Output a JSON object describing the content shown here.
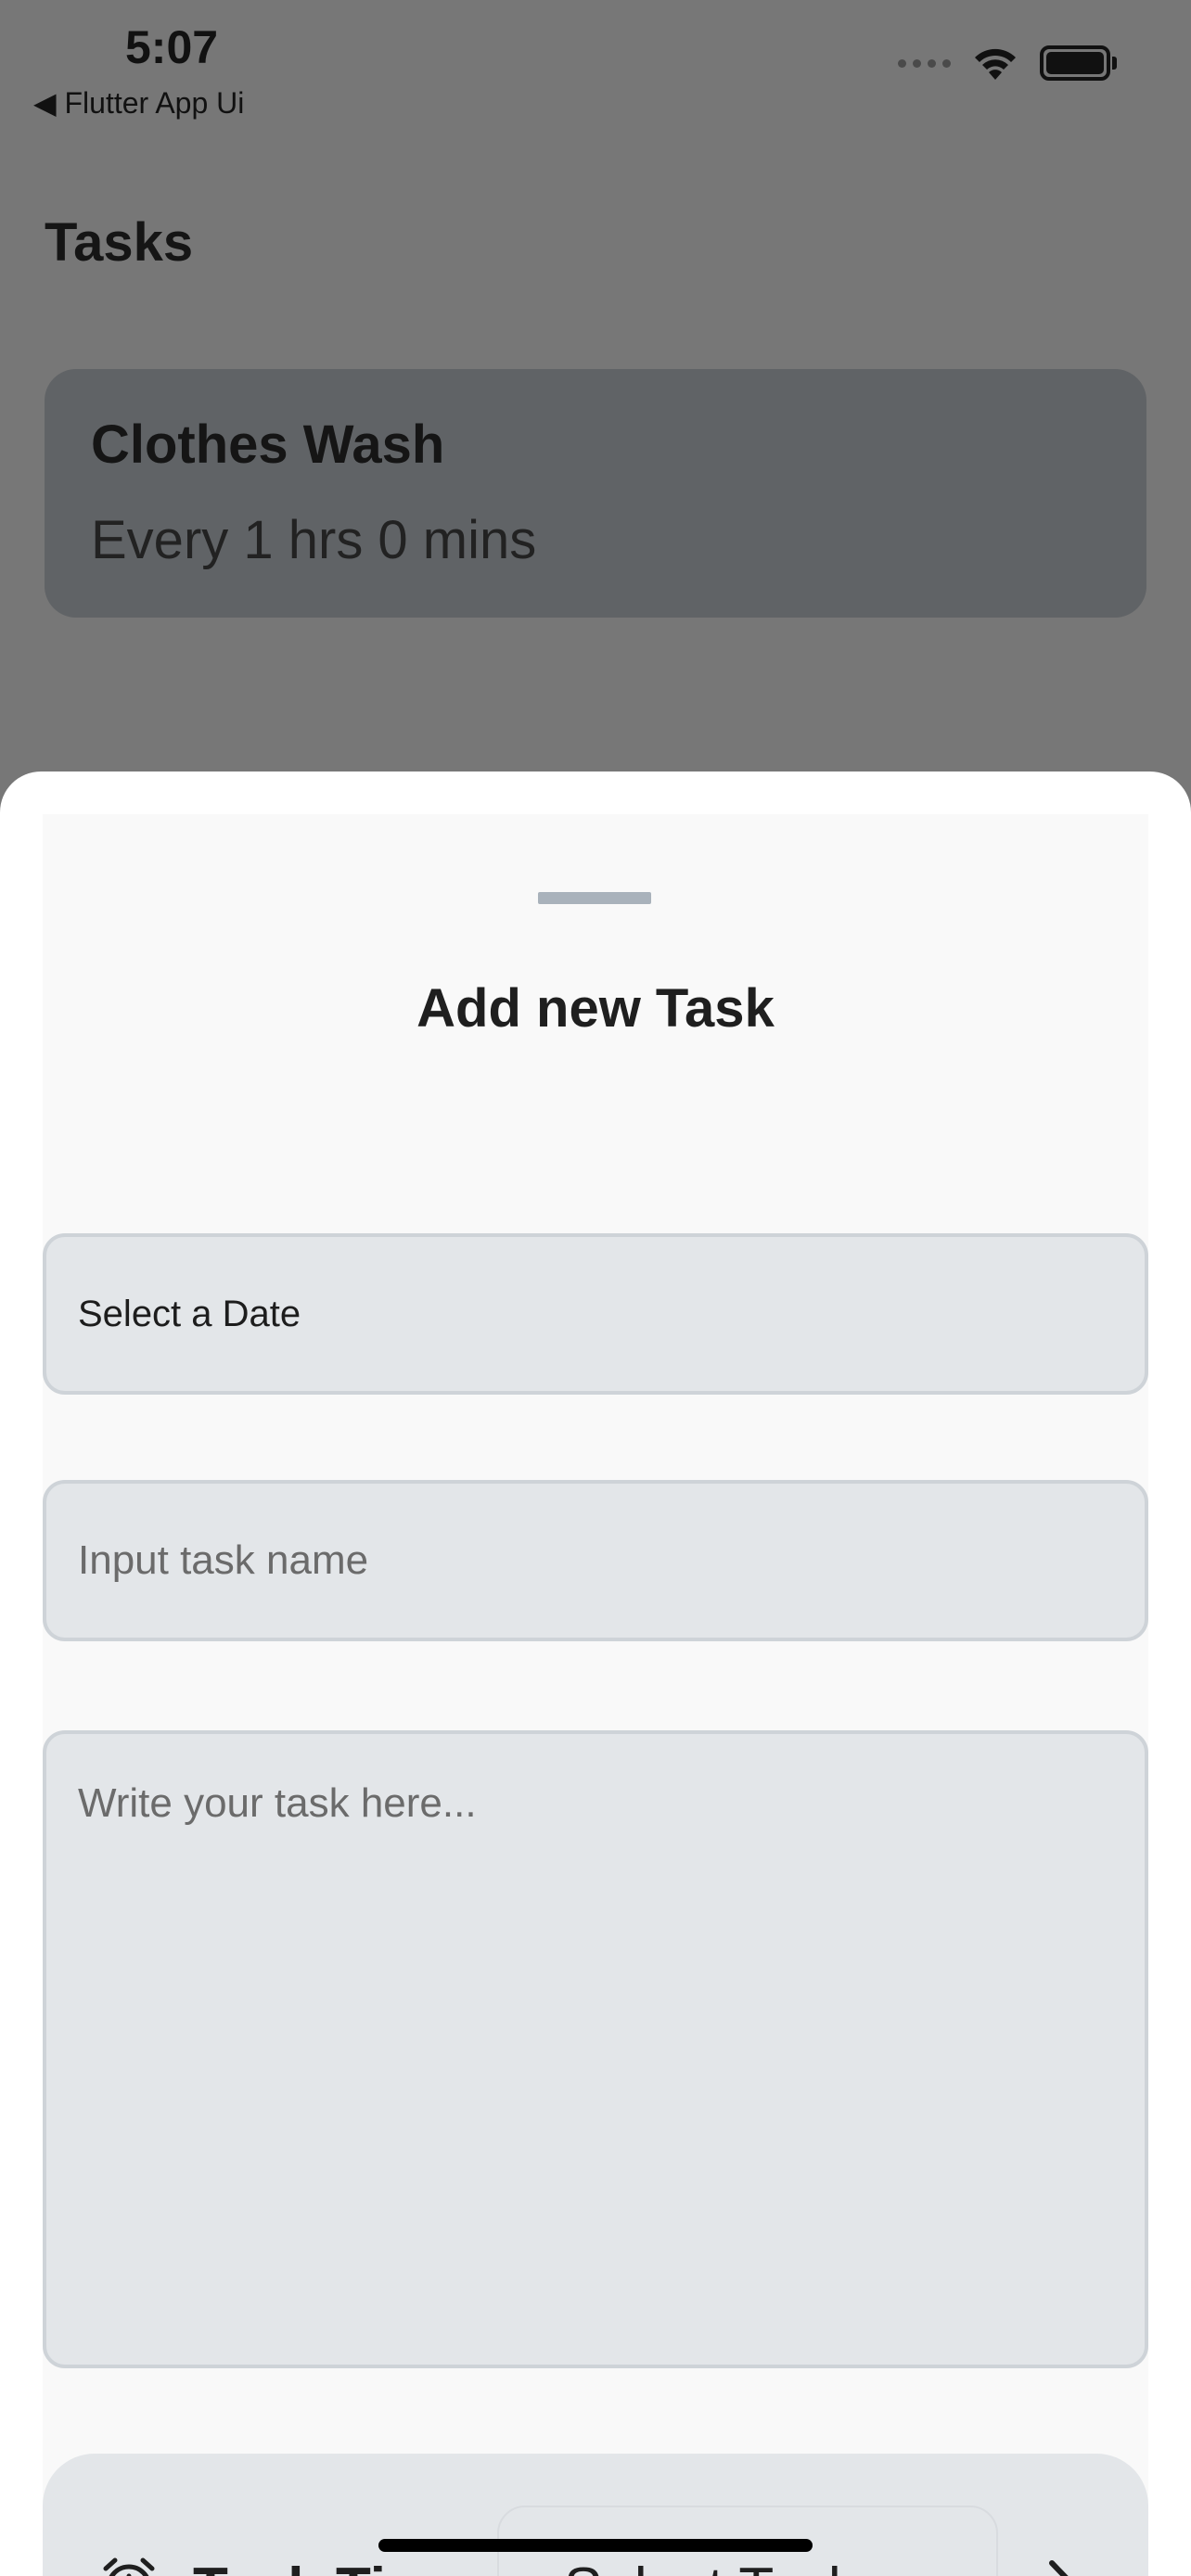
{
  "status_bar": {
    "time": "5:07",
    "back_label": "◀ Flutter App Ui",
    "icons": [
      "signal-dots-icon",
      "wifi-icon",
      "battery-icon"
    ]
  },
  "page": {
    "title": "Tasks"
  },
  "tasks": [
    {
      "name": "Clothes Wash",
      "interval": "Every 1 hrs 0 mins"
    }
  ],
  "sheet": {
    "title": "Add new Task",
    "date_field": "Select a Date",
    "name_field": {
      "value": "",
      "placeholder": "Input task name"
    },
    "description_field": {
      "value": "",
      "placeholder": "Write your task here..."
    },
    "task_time": {
      "label": "Task Time",
      "select_text": "Select Task ...",
      "icons": [
        "alarm-clock-icon",
        "chevron-right-icon"
      ]
    }
  },
  "colors": {
    "overlay": "#777777",
    "card": "#606366",
    "sheet": "#f9f9f9",
    "field_bg": "#e3e6e9",
    "field_border": "#ced3d8",
    "handle": "#a9b2bb"
  }
}
